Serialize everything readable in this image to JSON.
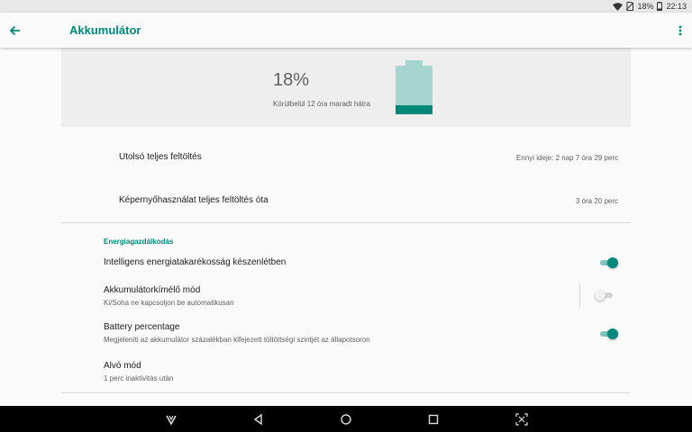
{
  "status_bar": {
    "battery_percent": "18%",
    "time": "22:13",
    "icons": [
      "wifi-icon",
      "no-sim-icon",
      "battery-icon"
    ]
  },
  "app_bar": {
    "title": "Akkumulátor",
    "back_icon": "arrow-left-icon",
    "menu_icon": "more-vert-icon"
  },
  "battery_header": {
    "percent": "18%",
    "remaining": "Körülbelül 12 óra maradt hátra",
    "level": 0.18,
    "colors": {
      "body": "#a6d5d0",
      "fill": "#00897b"
    }
  },
  "usage": {
    "last_full_charge": {
      "label": "Utolsó teljes feltöltés",
      "value": "Ennyi ideje: 2 nap 7 óra 29 perc"
    },
    "screen_usage": {
      "label": "Képernyőhasználat teljes feltöltés óta",
      "value": "3 óra 20 perc"
    }
  },
  "power_management": {
    "section_title": "Energiagazdálkodás",
    "smart_standby": {
      "title": "Intelligens energiatakarékosság készenlétben",
      "enabled": true
    },
    "battery_saver": {
      "title": "Akkumulátorkímélő mód",
      "summary": "Ki/Soha ne kapcsoljon be automatikusan",
      "enabled": false
    },
    "battery_percentage": {
      "title": "Battery percentage",
      "summary": "Megjeleníti az akkumulátor százalékban kifejezett töltöttségi szintjét az állapotsoron",
      "enabled": true
    },
    "sleep": {
      "title": "Alvó mód",
      "summary": "1 perc inaktivitás után"
    }
  },
  "nav_bar": {
    "icons": [
      "app-logo-icon",
      "back-triangle-icon",
      "home-circle-icon",
      "recents-square-icon",
      "screenshot-icon"
    ]
  },
  "theme": {
    "accent": "#00897b"
  }
}
